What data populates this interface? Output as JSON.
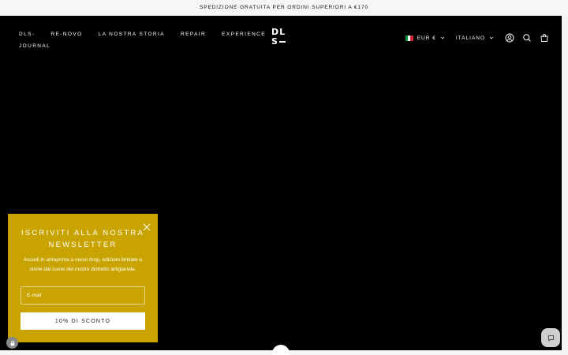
{
  "announcement": {
    "text": "SPEDIZIONE GRATUITA PER ORDINI SUPERIORI A €170"
  },
  "nav": {
    "items": [
      {
        "label": "DLS-"
      },
      {
        "label": "RE-NOVO"
      },
      {
        "label": "LA NOSTRA STORIA"
      },
      {
        "label": "REPAIR"
      },
      {
        "label": "EXPERIENCE"
      },
      {
        "label": "JOURNAL"
      }
    ]
  },
  "logo": {
    "line1": "DL",
    "line2": "S"
  },
  "header": {
    "currency": "EUR €",
    "language": "ITALIANO",
    "flag_colors": [
      "#009246",
      "#ffffff",
      "#ce2b37"
    ]
  },
  "newsletter": {
    "title": "ISCRIVITI ALLA NOSTRA NEWSLETTER",
    "text": "Accedi in anteprima a nuovi drop, edizioni limitate e storie dal cuore del nostro distretto artigianale.",
    "email_placeholder": "E-mail",
    "button": "10% DI SCONTO",
    "bg_color": "#c9a400"
  },
  "icons": {
    "account": "account-icon",
    "search": "search-icon",
    "cart": "cart-icon",
    "close": "close-icon",
    "lock": "lock-icon",
    "chat": "chat-icon"
  }
}
